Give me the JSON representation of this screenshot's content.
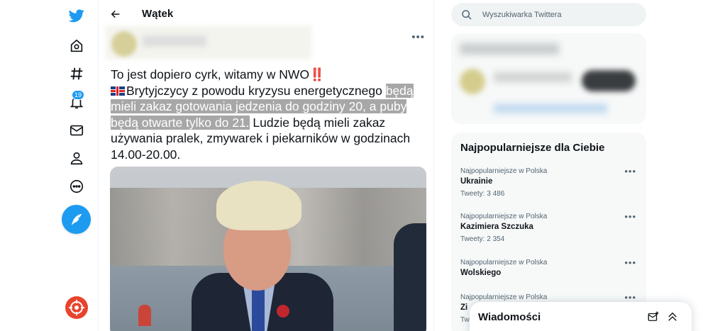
{
  "header": {
    "title": "Wątek"
  },
  "nav": {
    "notifications_count": "19"
  },
  "tweet": {
    "line1": "To jest dopiero cyrk, witamy w NWO",
    "bang": "‼️",
    "part2": "Brytyjczycy z powodu kryzysu energetycznego ",
    "highlighted": "będą mieli zakaz gotowania jedzenia do godziny 20, a puby będą otwarte tylko do 21.",
    "part3": " Ludzie będą mieli zakaz używania pralek, zmywarek i piekarników w godzinach 14.00-20.00."
  },
  "search": {
    "placeholder": "Wyszukiwarka Twittera"
  },
  "trends": {
    "title": "Najpopularniejsze dla Ciebie",
    "items": [
      {
        "context": "Najpopularniejsze w Polska",
        "name": "Ukrainie",
        "count": "Tweety: 3 486"
      },
      {
        "context": "Najpopularniejsze w Polska",
        "name": "Kazimiera Szczuka",
        "count": "Tweety: 2 354"
      },
      {
        "context": "Najpopularniejsze w Polska",
        "name": "Wolskiego",
        "count": ""
      },
      {
        "context": "Najpopularniejsze w Polska",
        "name": "Zi",
        "count": "Tw"
      }
    ]
  },
  "messages": {
    "title": "Wiadomości"
  },
  "colors": {
    "accent": "#1d9bf0",
    "highlight": "#a7a7a7"
  }
}
